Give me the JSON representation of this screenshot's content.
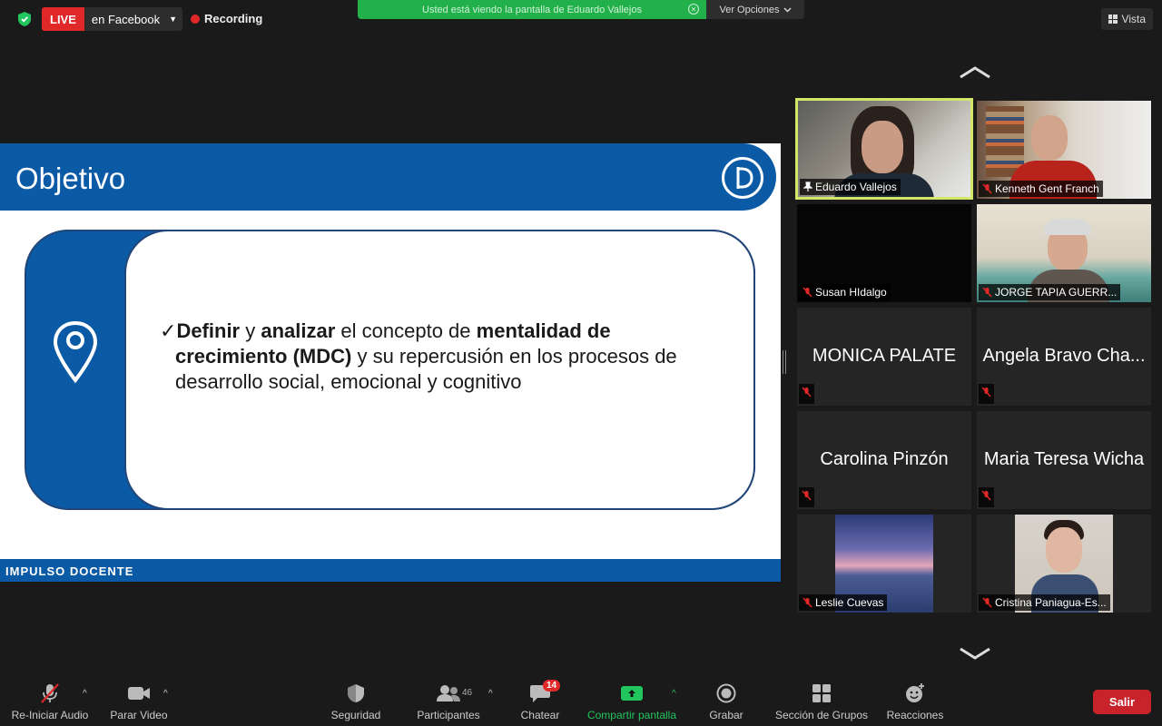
{
  "top_bar": {
    "live_label": "LIVE",
    "live_destination": "en Facebook",
    "recording_label": "Recording",
    "viewing_banner": "Usted está viendo la pantalla de Eduardo Vallejos",
    "view_options": "Ver Opciones",
    "view_button": "Vista"
  },
  "slide": {
    "title": "Objetivo",
    "text_parts": {
      "check": "✓",
      "p1": "Definir",
      "p2": " y ",
      "p3": "analizar",
      "p4": " el concepto de ",
      "p5": "mentalidad de crecimiento (MDC)",
      "p6": " y su repercusión en los procesos de desarrollo social, emocional y cognitivo"
    },
    "footer": "IMPULSO DOCENTE"
  },
  "gallery": [
    {
      "name": "Eduardo Vallejos",
      "type": "video",
      "active": true,
      "pinned": true
    },
    {
      "name": "Kenneth Gent Franch",
      "type": "video",
      "muted": true
    },
    {
      "name": "Susan HIdalgo",
      "type": "video-off",
      "muted": true
    },
    {
      "name": "JORGE TAPIA GUERR...",
      "type": "video",
      "muted": true
    },
    {
      "name": "MONICA PALATE",
      "type": "name-only",
      "muted": true
    },
    {
      "name": "Angela Bravo Cha...",
      "type": "name-only",
      "muted": true
    },
    {
      "name": "Carolina Pinzón",
      "type": "name-only",
      "muted": true
    },
    {
      "name": "Maria Teresa Wicha",
      "type": "name-only",
      "muted": true
    },
    {
      "name": "Leslie Cuevas",
      "type": "video",
      "muted": true
    },
    {
      "name": "Cristina Paniagua-Es...",
      "type": "video",
      "muted": true
    }
  ],
  "toolbar": {
    "audio": "Re-Iniciar Audio",
    "video": "Parar Video",
    "security": "Seguridad",
    "participants": "Participantes",
    "participants_count": "46",
    "chat": "Chatear",
    "chat_badge": "14",
    "share": "Compartir pantalla",
    "record": "Grabar",
    "breakout": "Sección de Grupos",
    "reactions": "Reacciones",
    "leave": "Salir"
  },
  "colors": {
    "slide_blue": "#0b5aa5",
    "live_red": "#e02828",
    "banner_green": "#22b04a",
    "active_speaker": "#d4e66a",
    "leave_red": "#c8222b"
  }
}
